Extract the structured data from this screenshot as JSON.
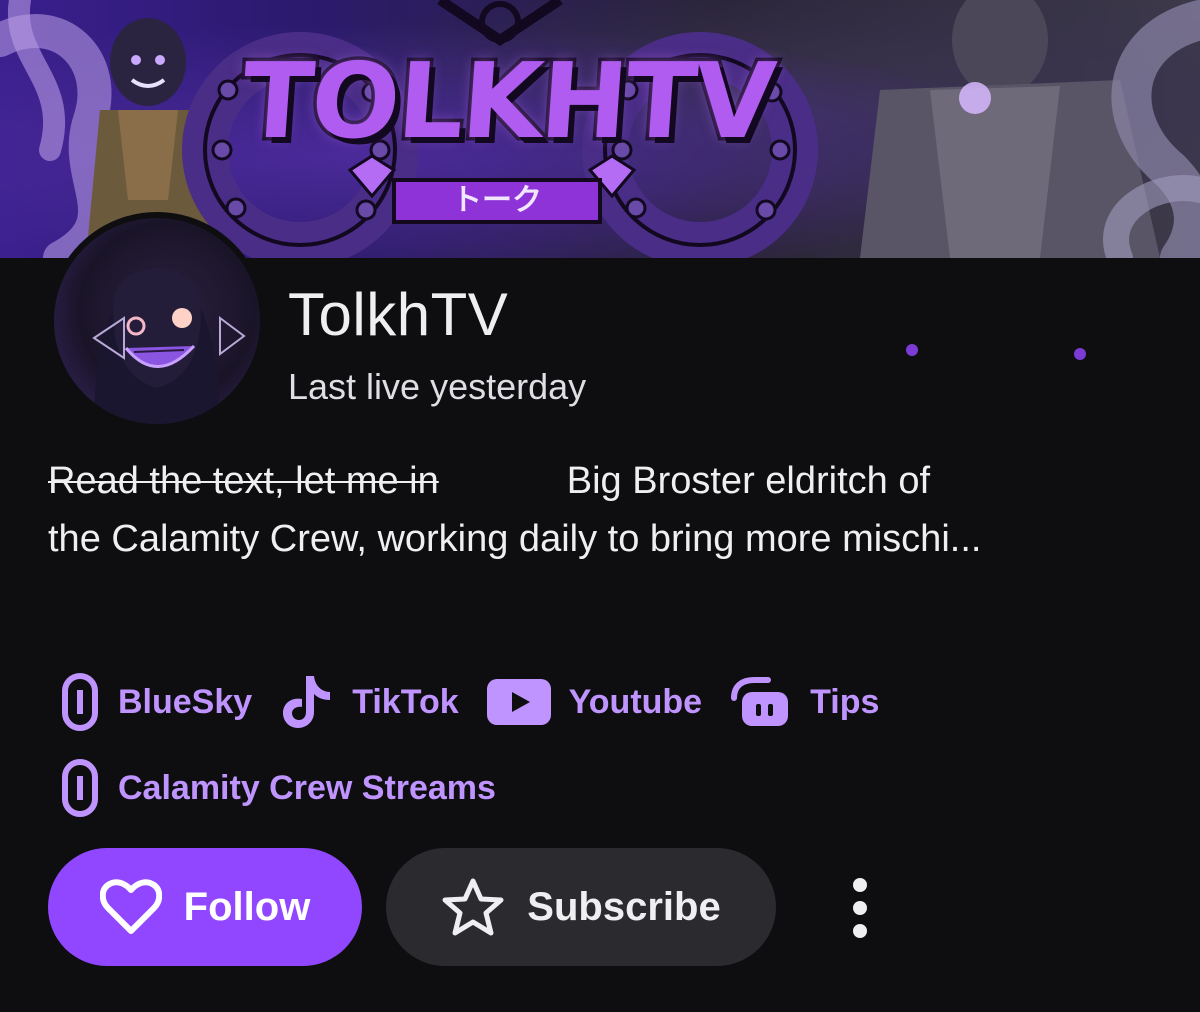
{
  "banner": {
    "logo_text": "TOLKHTV",
    "logo_subtext": "トーク"
  },
  "profile": {
    "channel_name": "TolkhTV",
    "status": "Last live yesterday"
  },
  "bio": {
    "struck_text": "Read the text, let me in",
    "text_line_1": "Big Broster eldritch of",
    "text_line_2": "the Calamity Crew, working daily to bring more mischi..."
  },
  "links": [
    {
      "label": "BlueSky",
      "icon": "link-icon"
    },
    {
      "label": "TikTok",
      "icon": "tiktok-icon"
    },
    {
      "label": "Youtube",
      "icon": "youtube-icon"
    },
    {
      "label": "Tips",
      "icon": "streamlabs-icon"
    },
    {
      "label": "Calamity Crew Streams",
      "icon": "link-icon"
    }
  ],
  "actions": {
    "follow_label": "Follow",
    "subscribe_label": "Subscribe",
    "more_icon": "more-vertical-icon"
  },
  "colors": {
    "background": "#0e0e10",
    "accent": "#9147ff",
    "link": "#bf94ff",
    "secondary_button": "#2a2a2f"
  }
}
